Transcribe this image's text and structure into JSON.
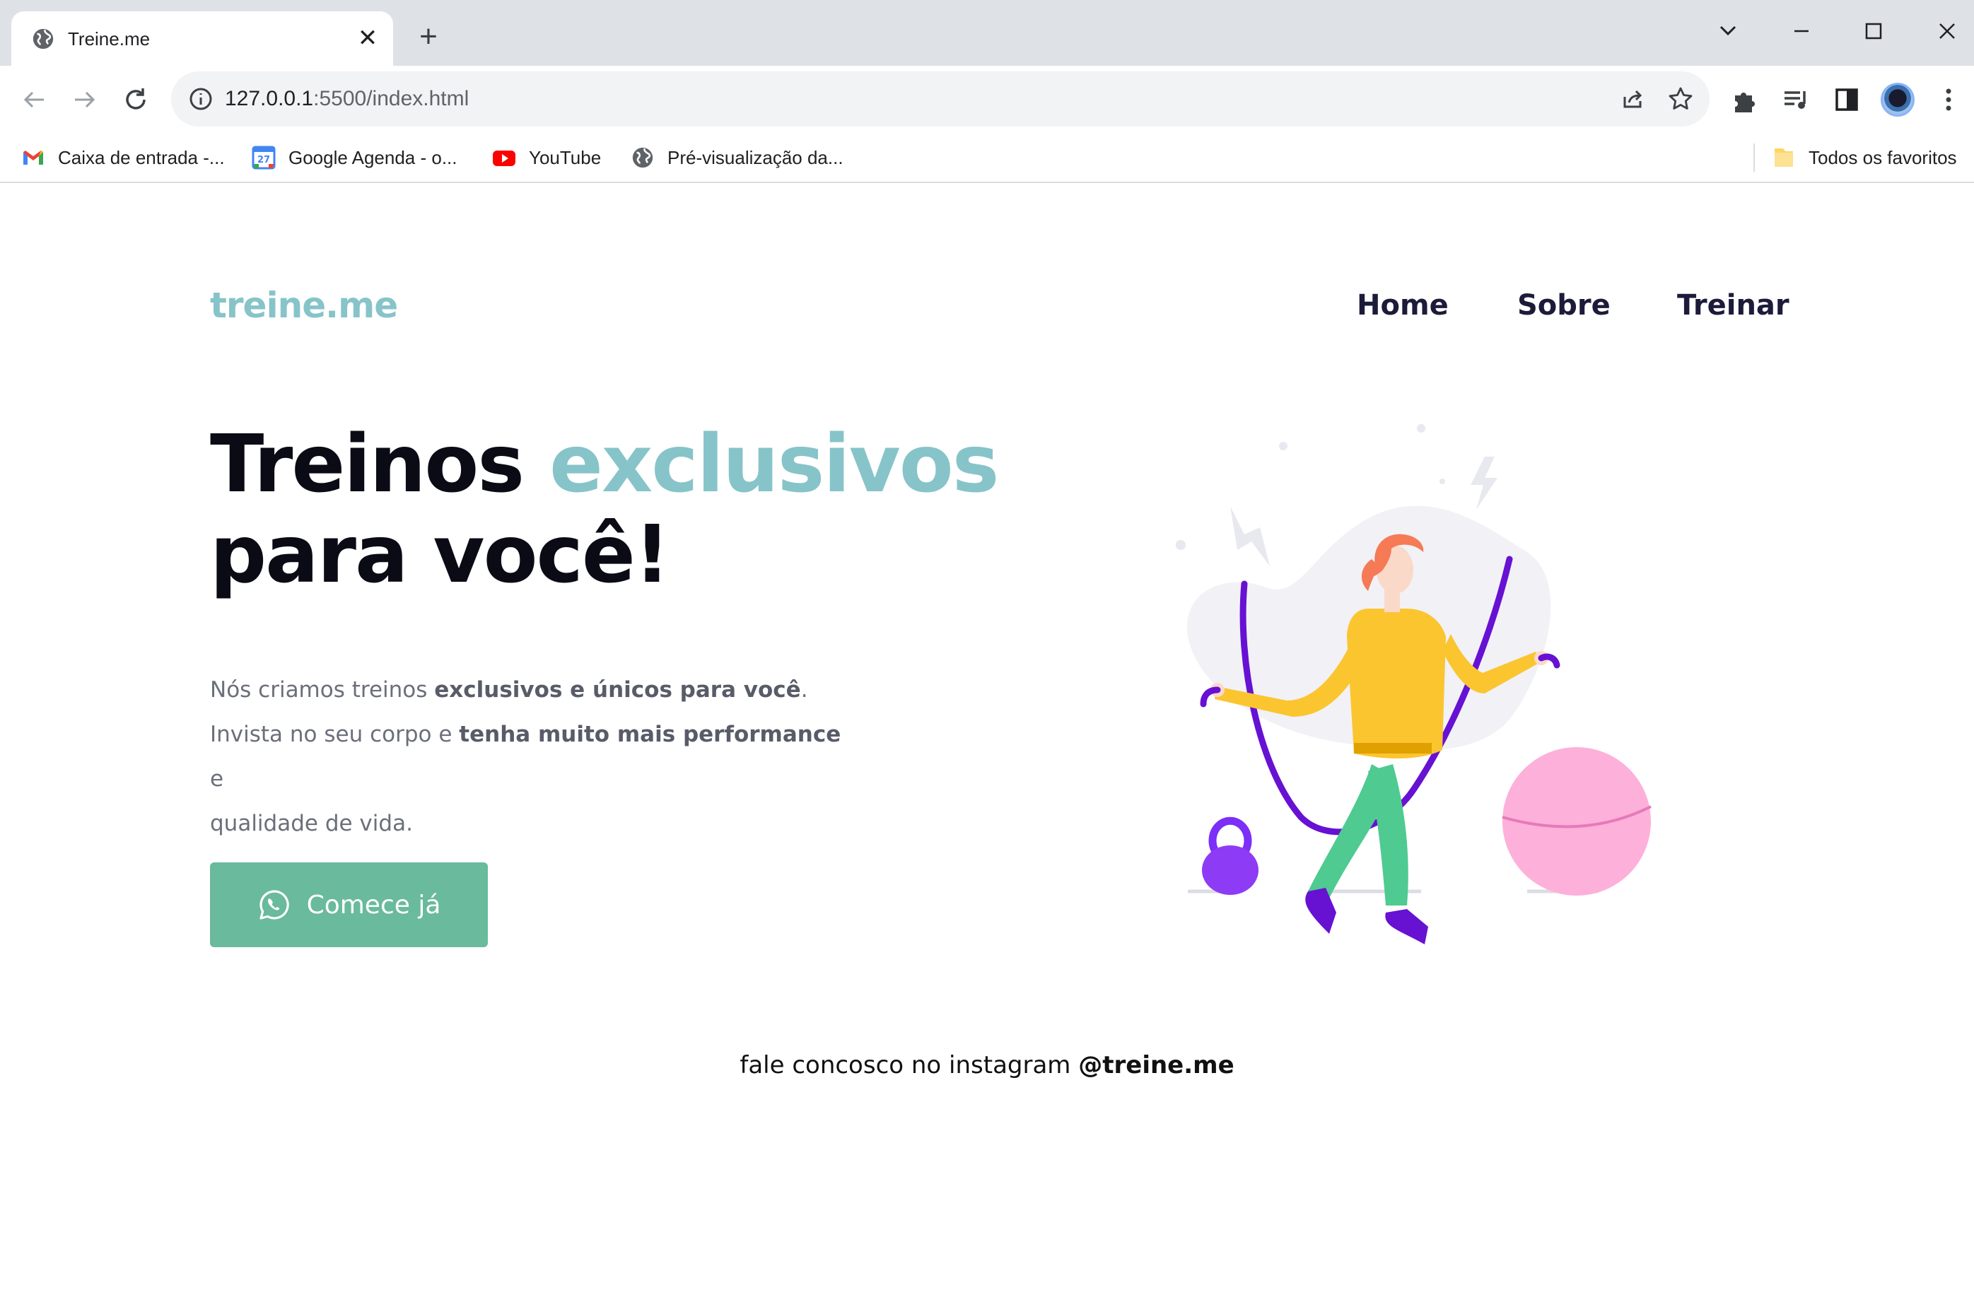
{
  "browser": {
    "tab_title": "Treine.me",
    "url_host": "127.0.0.1",
    "url_rest": ":5500/index.html",
    "bookmarks": [
      {
        "label": "Caixa de entrada -...",
        "icon": "gmail-icon"
      },
      {
        "label": "Google Agenda - o...",
        "icon": "calendar-icon"
      },
      {
        "label": "YouTube",
        "icon": "youtube-icon"
      },
      {
        "label": "Pré-visualização da...",
        "icon": "globe-icon"
      }
    ],
    "all_bookmarks_label": "Todos os favoritos",
    "calendar_day": "27"
  },
  "site": {
    "logo": "treine.me",
    "nav": [
      "Home",
      "Sobre",
      "Treinar"
    ],
    "headline_part1": "Treinos ",
    "headline_accent": "exclusivos",
    "headline_part2": "para você!",
    "desc_1a": "Nós criamos treinos ",
    "desc_1b": "exclusivos e únicos para você",
    "desc_1c": ".",
    "desc_2a": "Invista no seu corpo e ",
    "desc_2b": "tenha muito mais performance",
    "desc_2c": " e",
    "desc_3": "qualidade de vida.",
    "cta_label": "Comece já",
    "footer_text": "fale concosco no instagram ",
    "footer_handle": "@treine.me"
  },
  "colors": {
    "accent": "#86c4c9",
    "cta": "#6aba9d",
    "nav_text": "#1d1b3a"
  }
}
